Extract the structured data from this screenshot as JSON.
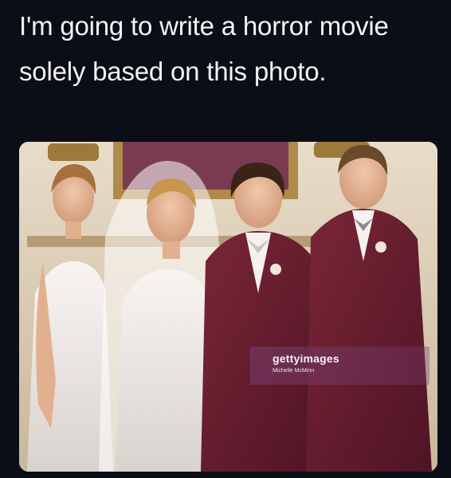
{
  "post": {
    "caption": "I'm going to write a horror movie solely based on this photo."
  },
  "photo": {
    "watermark": {
      "brand": "gettyimages",
      "credit": "Michelle McMinn"
    }
  },
  "colors": {
    "background": "#0b0e16",
    "caption_text": "#f3f3f3",
    "suit_maroon": "#6b1f33",
    "dress_white": "#f2efec",
    "wall": "#d9cdb9"
  }
}
